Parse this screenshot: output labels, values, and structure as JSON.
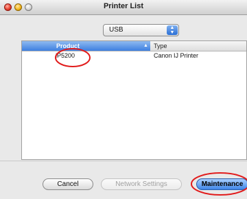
{
  "window": {
    "title": "Printer List"
  },
  "connection_popup": {
    "selected": "USB",
    "arrows_icon": "popup-arrows-icon"
  },
  "table": {
    "columns": [
      "Product",
      "Type"
    ],
    "rows": [
      {
        "product": "iP5200",
        "type": "Canon IJ Printer"
      }
    ]
  },
  "buttons": {
    "cancel": "Cancel",
    "network_settings": "Network Settings",
    "maintenance": "Maintenance"
  },
  "annotation_color": "#e11b1b"
}
